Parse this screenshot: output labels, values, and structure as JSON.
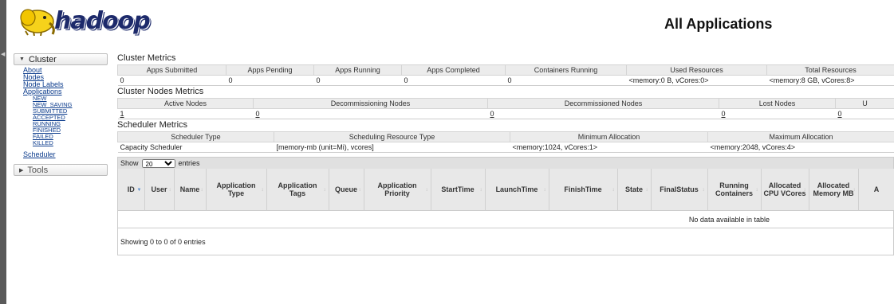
{
  "logo": {
    "wordmark": "hadoop"
  },
  "page_title": "All Applications",
  "sidebar": {
    "cluster_label": "Cluster",
    "cluster_links": [
      "About",
      "Nodes",
      "Node Labels",
      "Applications"
    ],
    "app_states": [
      "NEW",
      "NEW_SAVING",
      "SUBMITTED",
      "ACCEPTED",
      "RUNNING",
      "FINISHED",
      "FAILED",
      "KILLED"
    ],
    "scheduler_link": "Scheduler",
    "tools_label": "Tools"
  },
  "cluster_metrics": {
    "title": "Cluster Metrics",
    "headers": [
      "Apps Submitted",
      "Apps Pending",
      "Apps Running",
      "Apps Completed",
      "Containers Running",
      "Used Resources",
      "Total Resources"
    ],
    "values": [
      "0",
      "0",
      "0",
      "0",
      "0",
      "<memory:0 B, vCores:0>",
      "<memory:8 GB, vCores:8>"
    ]
  },
  "nodes_metrics": {
    "title": "Cluster Nodes Metrics",
    "headers": [
      "Active Nodes",
      "Decommissioning Nodes",
      "Decommissioned Nodes",
      "Lost Nodes",
      "U"
    ],
    "values": [
      "1",
      "0",
      "0",
      "0",
      "0"
    ]
  },
  "scheduler_metrics": {
    "title": "Scheduler Metrics",
    "headers": [
      "Scheduler Type",
      "Scheduling Resource Type",
      "Minimum Allocation",
      "Maximum Allocation"
    ],
    "values": [
      "Capacity Scheduler",
      "[memory-mb (unit=Mi), vcores]",
      "<memory:1024, vCores:1>",
      "<memory:2048, vCores:4>"
    ]
  },
  "apps_table": {
    "show_label": "Show",
    "entries_value": "20",
    "entries_label": "entries",
    "columns": [
      "ID",
      "User",
      "Name",
      "Application Type",
      "Application Tags",
      "Queue",
      "Application Priority",
      "StartTime",
      "LaunchTime",
      "FinishTime",
      "State",
      "FinalStatus",
      "Running Containers",
      "Allocated CPU VCores",
      "Allocated Memory MB",
      "A"
    ],
    "no_data": "No data available in table",
    "showing": "Showing 0 to 0 of 0 entries"
  }
}
